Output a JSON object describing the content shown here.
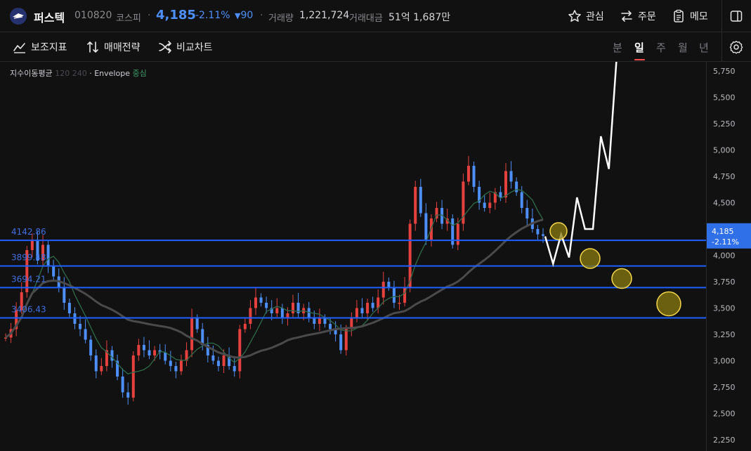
{
  "header": {
    "stock_name": "퍼스텍",
    "stock_code": "010820",
    "market": "코스피",
    "price": "4,185",
    "change_pct": "-2.11%",
    "change_arrow": "▼",
    "change_abs": "90",
    "volume_label": "거래량",
    "volume_value": "1,221,724",
    "amount_label": "거래대금",
    "amount_value": "51억 1,687만",
    "buttons": {
      "watch": "관심",
      "order": "주문",
      "memo": "메모"
    }
  },
  "toolbar": {
    "indicators": "보조지표",
    "strategy": "매매전략",
    "compare": "비교차트",
    "timeframes": [
      "분",
      "일",
      "주",
      "월",
      "년"
    ],
    "active_timeframe": "일"
  },
  "indicator_legend": {
    "ma_label": "지수이동평균",
    "ma_periods": "120 240",
    "envelope_label": "Envelope",
    "envelope_mode": "중심"
  },
  "colors": {
    "up": "#e5413f",
    "down": "#4d8ff7",
    "hline": "#1f5fff",
    "projection": "#ffffff",
    "target_fill": "#8a7a10",
    "target_stroke": "#f5d84a",
    "ma_green": "#2f6b4a",
    "ma_grey": "#4a4a4a"
  },
  "chart_data": {
    "type": "line",
    "ylim": [
      2200,
      5850
    ],
    "yticks": [
      "5,750",
      "5,500",
      "5,250",
      "5,000",
      "4,750",
      "4,500",
      "4,250",
      "4,000",
      "3,750",
      "3,500",
      "3,250",
      "3,000",
      "2,750",
      "2,500",
      "2,250"
    ],
    "ytick_values": [
      5750,
      5500,
      5250,
      5000,
      4750,
      4500,
      4250,
      4000,
      3750,
      3500,
      3250,
      3000,
      2750,
      2500,
      2250
    ],
    "current_price": {
      "price": "4,185",
      "change": "-2.11%",
      "value": 4185
    },
    "horizontal_levels": [
      {
        "label": "4142.86",
        "value": 4142.86
      },
      {
        "label": "3899.48",
        "value": 3899.48
      },
      {
        "label": "3694.21",
        "value": 3694.21
      },
      {
        "label": "3406.43",
        "value": 3406.43
      }
    ],
    "series": [
      {
        "values": [
          3220,
          3300,
          3480,
          3650,
          4050,
          4150,
          3950,
          4100,
          3900,
          3800,
          3700,
          3550,
          3450,
          3350,
          3300,
          3200,
          3050,
          2900,
          2950,
          3100,
          3000,
          2850,
          2700,
          2650,
          3050,
          3150,
          3100,
          3050,
          3100,
          3080,
          3000,
          2950,
          2900,
          3000,
          3100,
          3400,
          3300,
          3150,
          3050,
          3000,
          2950,
          3050,
          2950,
          2900,
          3300,
          3350,
          3500,
          3600,
          3550,
          3500,
          3450,
          3500,
          3400,
          3450,
          3550,
          3450,
          3500,
          3400,
          3350,
          3400,
          3350,
          3300,
          3250,
          3100,
          3300,
          3400,
          3500,
          3450,
          3550,
          3500,
          3600,
          3750,
          3700,
          3550,
          3550,
          3700,
          4300,
          4650,
          4400,
          4150,
          4350,
          4450,
          4300,
          4350,
          4100,
          4300,
          4700,
          4850,
          4650,
          4500,
          4450,
          4500,
          4600,
          4550,
          4800,
          4700,
          4600,
          4450,
          4350,
          4250,
          4200,
          4185
        ]
      }
    ],
    "projection": [
      4180,
      3920,
      4200,
      3980,
      4550,
      4250,
      4250,
      5130,
      4820,
      5900
    ],
    "target_circles": [
      4230,
      3970,
      3780,
      3540
    ]
  }
}
